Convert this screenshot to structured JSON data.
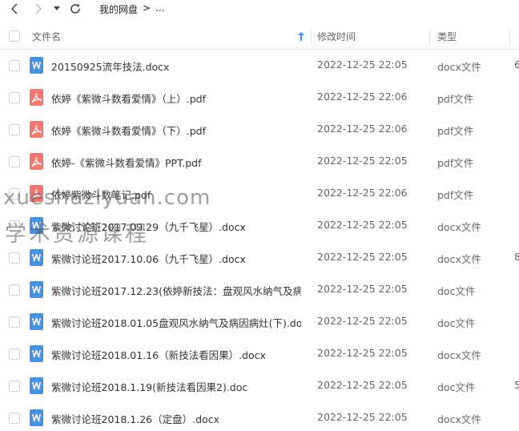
{
  "toolbar": {
    "back_icon": "chevron-left-icon",
    "forward_icon": "chevron-right-icon",
    "dropdown_icon": "caret-down-icon",
    "refresh_icon": "refresh-icon",
    "breadcrumb": [
      "我的网盘",
      ">",
      "..."
    ]
  },
  "table": {
    "columns": {
      "name": "文件名",
      "modified": "修改时间",
      "type": "类型"
    },
    "sort_icon": "sort-arrow-up-icon",
    "sort_color": "#3b8cff",
    "rows": [
      {
        "name": "20150925流年技法.docx",
        "date": "2022-12-25 22:05",
        "type": "docx文件",
        "kind": "docx",
        "size": "6"
      },
      {
        "name": "依婷《紫微斗数看爱情》（上）.pdf",
        "date": "2022-12-25 22:06",
        "type": "pdf文件",
        "kind": "pdf",
        "size": ""
      },
      {
        "name": "依婷《紫微斗数看爱情》（下）.pdf",
        "date": "2022-12-25 22:06",
        "type": "pdf文件",
        "kind": "pdf",
        "size": ""
      },
      {
        "name": "依婷-《紫微斗数看爱情》PPT.pdf",
        "date": "2022-12-25 22:05",
        "type": "pdf文件",
        "kind": "pdf",
        "size": ""
      },
      {
        "name": "依婷紫微斗数笔记.pdf",
        "date": "2022-12-25 22:06",
        "type": "pdf文件",
        "kind": "pdf",
        "size": ""
      },
      {
        "name": "紫微讨论班2017.09.29（九千飞星）.docx",
        "date": "2022-12-25 22:05",
        "type": "docx文件",
        "kind": "docx",
        "size": ""
      },
      {
        "name": "紫微讨论班2017.10.06（九千飞星）.docx",
        "date": "2022-12-25 22:05",
        "type": "docx文件",
        "kind": "docx",
        "size": "8"
      },
      {
        "name": "紫微讨论班2017.12.23(依婷新技法：盘观风水纳气及病...",
        "date": "2022-12-25 22:05",
        "type": "doc文件",
        "kind": "docx",
        "size": ""
      },
      {
        "name": "紫微讨论班2018.01.05盘观风水纳气及病因病灶(下).doc",
        "date": "2022-12-25 22:05",
        "type": "doc文件",
        "kind": "docx",
        "size": ""
      },
      {
        "name": "紫微讨论班2018.01.16（新技法看因果）.docx",
        "date": "2022-12-25 22:05",
        "type": "docx文件",
        "kind": "docx",
        "size": ""
      },
      {
        "name": "紫微讨论班2018.1.19(新技法看因果2).doc",
        "date": "2022-12-25 22:05",
        "type": "doc文件",
        "kind": "docx",
        "size": "5"
      },
      {
        "name": "紫微讨论班2018.1.26（定盘）.docx",
        "date": "2022-12-25 22:05",
        "type": "docx文件",
        "kind": "docx",
        "size": ""
      }
    ]
  },
  "watermark": {
    "line1": "xueshuziyuan.com",
    "line2": "学术资源课程"
  },
  "colors": {
    "docx_icon": "#4a90e2",
    "pdf_icon": "#f07a72"
  }
}
